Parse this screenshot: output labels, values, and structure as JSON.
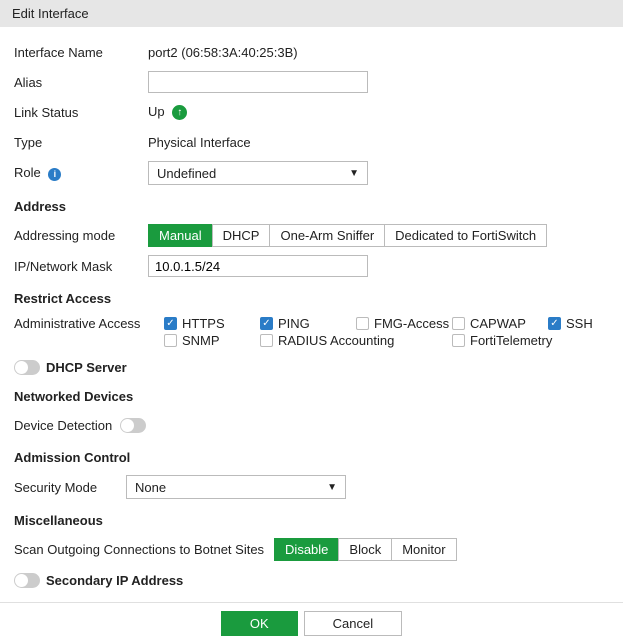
{
  "header": {
    "title": "Edit Interface"
  },
  "fields": {
    "interface_name_label": "Interface Name",
    "interface_name_value": "port2 (06:58:3A:40:25:3B)",
    "alias_label": "Alias",
    "alias_value": "",
    "link_status_label": "Link Status",
    "link_status_value": "Up",
    "type_label": "Type",
    "type_value": "Physical Interface",
    "role_label": "Role",
    "role_value": "Undefined"
  },
  "sections": {
    "address": "Address",
    "restrict": "Restrict Access",
    "networked_devices": "Networked Devices",
    "admission_control": "Admission Control",
    "miscellaneous": "Miscellaneous"
  },
  "addressing": {
    "label": "Addressing mode",
    "options": {
      "manual": "Manual",
      "dhcp": "DHCP",
      "sniffer": "One-Arm Sniffer",
      "fortiswitch": "Dedicated to FortiSwitch"
    },
    "ip_label": "IP/Network Mask",
    "ip_value": "10.0.1.5/24"
  },
  "admin_access": {
    "label": "Administrative Access",
    "https": "HTTPS",
    "ping": "PING",
    "fmg": "FMG-Access",
    "capwap": "CAPWAP",
    "ssh": "SSH",
    "snmp": "SNMP",
    "radius": "RADIUS Accounting",
    "fortitelemetry": "FortiTelemetry"
  },
  "toggles": {
    "dhcp_server": "DHCP Server",
    "secondary_ip": "Secondary IP Address"
  },
  "device_detection_label": "Device Detection",
  "security_mode": {
    "label": "Security Mode",
    "value": "None"
  },
  "botnet": {
    "label": "Scan Outgoing Connections to Botnet Sites",
    "disable": "Disable",
    "block": "Block",
    "monitor": "Monitor"
  },
  "buttons": {
    "ok": "OK",
    "cancel": "Cancel"
  }
}
